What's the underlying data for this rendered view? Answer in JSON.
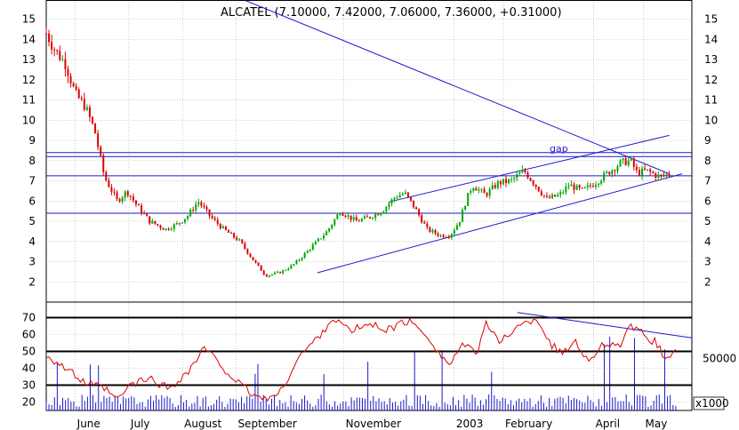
{
  "chart_data": [
    {
      "type": "candlestick",
      "title": "ALCATEL (7.10000, 7.42000, 7.06000, 7.36000, +0.31000)",
      "ylim": [
        1,
        15.6
      ],
      "y_ticks": [
        "2",
        "3",
        "4",
        "5",
        "6",
        "7",
        "8",
        "9",
        "10",
        "11",
        "12",
        "13",
        "14",
        "15"
      ],
      "y_ticks_right": [
        "2",
        "3",
        "4",
        "5",
        "6",
        "7",
        "8",
        "9",
        "10",
        "11",
        "12",
        "13",
        "14",
        "15"
      ],
      "x_labels": [
        "June",
        "July",
        "August",
        "September",
        "November",
        "2003",
        "February",
        "April",
        "May"
      ],
      "annotation": "gap",
      "horizontal_levels": [
        8.4,
        8.2,
        7.25,
        5.4
      ],
      "trendlines": [
        {
          "from": [
            0.28,
            16.3
          ],
          "to": [
            0.965,
            7.35
          ]
        },
        {
          "from": [
            0.53,
            5.95
          ],
          "to": [
            0.965,
            9.25
          ]
        },
        {
          "from": [
            0.42,
            2.45
          ],
          "to": [
            0.985,
            7.35
          ]
        }
      ],
      "price_path": [
        [
          0.0,
          14.3
        ],
        [
          0.015,
          13.4
        ],
        [
          0.03,
          12.8
        ],
        [
          0.045,
          11.3
        ],
        [
          0.06,
          10.7
        ],
        [
          0.075,
          9.5
        ],
        [
          0.09,
          7.2
        ],
        [
          0.11,
          6.0
        ],
        [
          0.125,
          6.5
        ],
        [
          0.14,
          5.8
        ],
        [
          0.16,
          5.0
        ],
        [
          0.185,
          4.6
        ],
        [
          0.205,
          4.9
        ],
        [
          0.22,
          5.3
        ],
        [
          0.235,
          6.0
        ],
        [
          0.255,
          5.2
        ],
        [
          0.275,
          4.6
        ],
        [
          0.3,
          4.0
        ],
        [
          0.32,
          3.1
        ],
        [
          0.34,
          2.3
        ],
        [
          0.365,
          2.5
        ],
        [
          0.385,
          2.9
        ],
        [
          0.41,
          3.7
        ],
        [
          0.435,
          4.5
        ],
        [
          0.455,
          5.5
        ],
        [
          0.48,
          5.0
        ],
        [
          0.5,
          5.2
        ],
        [
          0.52,
          5.5
        ],
        [
          0.54,
          6.2
        ],
        [
          0.555,
          6.4
        ],
        [
          0.57,
          5.7
        ],
        [
          0.59,
          4.6
        ],
        [
          0.61,
          4.3
        ],
        [
          0.625,
          4.3
        ],
        [
          0.64,
          5.0
        ],
        [
          0.65,
          6.0
        ],
        [
          0.66,
          6.8
        ],
        [
          0.68,
          6.3
        ],
        [
          0.7,
          6.9
        ],
        [
          0.72,
          7.0
        ],
        [
          0.74,
          7.5
        ],
        [
          0.76,
          6.7
        ],
        [
          0.775,
          6.1
        ],
        [
          0.795,
          6.3
        ],
        [
          0.81,
          6.8
        ],
        [
          0.83,
          6.5
        ],
        [
          0.85,
          6.9
        ],
        [
          0.87,
          7.4
        ],
        [
          0.89,
          7.9
        ],
        [
          0.905,
          8.0
        ],
        [
          0.915,
          7.4
        ],
        [
          0.93,
          7.5
        ],
        [
          0.95,
          7.2
        ],
        [
          0.965,
          7.36
        ]
      ]
    },
    {
      "type": "line",
      "name": "oscillator",
      "ylim": [
        15,
        75
      ],
      "y_ticks": [
        "20",
        "30",
        "40",
        "50",
        "60",
        "70"
      ],
      "levels": [
        70,
        50,
        30
      ],
      "trendline": {
        "from": [
          0.73,
          73
        ],
        "to": [
          1.0,
          58
        ]
      },
      "path": [
        [
          0.0,
          48
        ],
        [
          0.03,
          40
        ],
        [
          0.06,
          31
        ],
        [
          0.09,
          28
        ],
        [
          0.11,
          21
        ],
        [
          0.13,
          30
        ],
        [
          0.16,
          34
        ],
        [
          0.19,
          28
        ],
        [
          0.22,
          38
        ],
        [
          0.245,
          52
        ],
        [
          0.27,
          42
        ],
        [
          0.3,
          30
        ],
        [
          0.33,
          22
        ],
        [
          0.36,
          24
        ],
        [
          0.39,
          46
        ],
        [
          0.42,
          58
        ],
        [
          0.445,
          70
        ],
        [
          0.47,
          62
        ],
        [
          0.5,
          66
        ],
        [
          0.53,
          63
        ],
        [
          0.56,
          68
        ],
        [
          0.59,
          60
        ],
        [
          0.61,
          48
        ],
        [
          0.625,
          42
        ],
        [
          0.64,
          52
        ],
        [
          0.655,
          54
        ],
        [
          0.665,
          46
        ],
        [
          0.68,
          68
        ],
        [
          0.7,
          55
        ],
        [
          0.72,
          62
        ],
        [
          0.74,
          66
        ],
        [
          0.76,
          70
        ],
        [
          0.78,
          55
        ],
        [
          0.8,
          48
        ],
        [
          0.82,
          57
        ],
        [
          0.84,
          43
        ],
        [
          0.86,
          55
        ],
        [
          0.885,
          52
        ],
        [
          0.905,
          64
        ],
        [
          0.925,
          60
        ],
        [
          0.945,
          55
        ],
        [
          0.96,
          45
        ],
        [
          0.975,
          51
        ]
      ]
    },
    {
      "type": "bar",
      "name": "volume",
      "y_label_right": "50000",
      "unit_label": "x1000"
    }
  ]
}
